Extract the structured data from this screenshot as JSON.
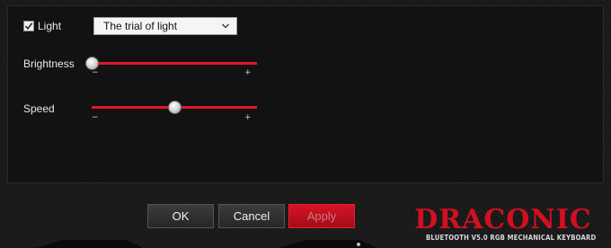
{
  "light": {
    "checked": true,
    "label": "Light"
  },
  "effect": {
    "selected": "The trial of light"
  },
  "brightness": {
    "label": "Brightness",
    "value": 0,
    "min_symbol": "−",
    "max_symbol": "+"
  },
  "speed": {
    "label": "Speed",
    "value": 0.5,
    "min_symbol": "−",
    "max_symbol": "+"
  },
  "buttons": {
    "ok": "OK",
    "cancel": "Cancel",
    "apply": "Apply"
  },
  "brand": {
    "name": "DRACONIC",
    "tagline": "BLUETOOTH V5.0 RGB MECHANICAL KEYBOARD"
  },
  "colors": {
    "accent": "#e0162b",
    "panel": "#121212",
    "background": "#1b1b1b"
  },
  "icons": {
    "checkbox": "checkmark-icon",
    "dropdown": "chevron-down-icon"
  }
}
